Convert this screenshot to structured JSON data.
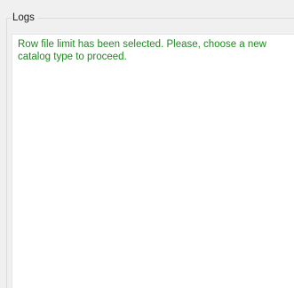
{
  "logs_panel": {
    "title": "Logs",
    "messages": [
      {
        "text": "Row file limit has been selected. Please, choose a new catalog type to proceed.",
        "status_color": "#1d8a1d"
      }
    ]
  }
}
